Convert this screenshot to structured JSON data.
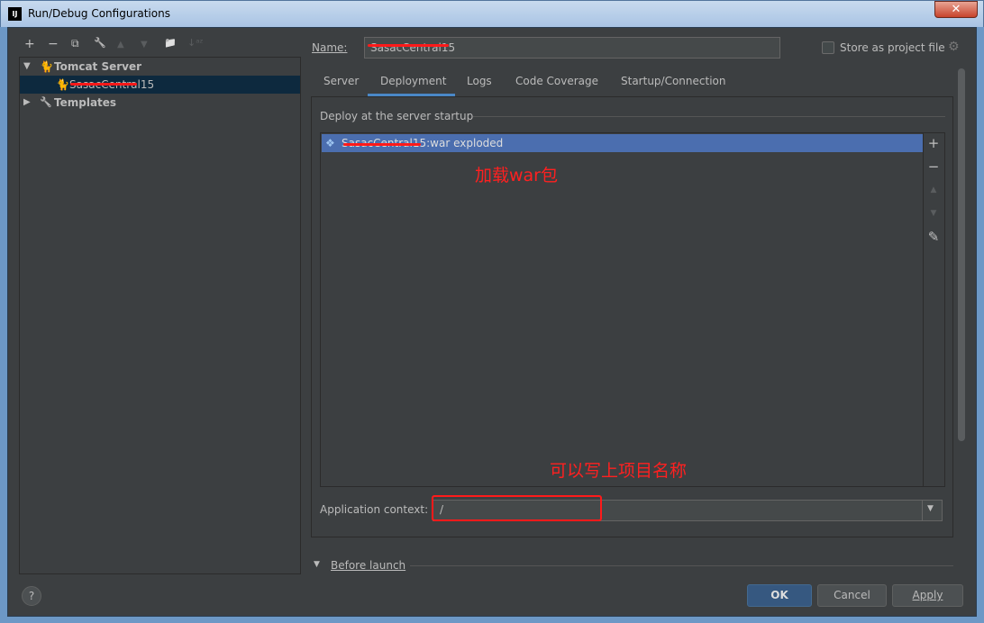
{
  "window": {
    "title": "Run/Debug Configurations",
    "app_icon": "IJ",
    "close": "✕"
  },
  "toolbar": {
    "add": "+",
    "remove": "−",
    "copy": "⧉",
    "edit": "🔧",
    "up": "▲",
    "down": "▼",
    "folder": "📁",
    "sort": "↓ᵃᶻ"
  },
  "tree": {
    "items": [
      {
        "label": "Tomcat Server",
        "arrow": "▼"
      },
      {
        "label": "SasacCentral15"
      },
      {
        "label": "Templates",
        "arrow": "▶"
      }
    ]
  },
  "name": {
    "label": "Name:",
    "value": "SasacCentral15"
  },
  "store": {
    "label": "Store as project file"
  },
  "tabs": [
    "Server",
    "Deployment",
    "Logs",
    "Code Coverage",
    "Startup/Connection"
  ],
  "deployment": {
    "section": "Deploy at the server startup",
    "items": [
      "SasacCentral15:war exploded"
    ],
    "side_buttons": [
      "+",
      "−",
      "▲",
      "▼",
      "✎"
    ]
  },
  "annotations": {
    "war": "加载war包",
    "context": "可以写上项目名称"
  },
  "context": {
    "label": "Application context:",
    "value": "/"
  },
  "before_launch": "Before launch",
  "buttons": {
    "help": "?",
    "ok": "OK",
    "cancel": "Cancel",
    "apply": "Apply"
  }
}
